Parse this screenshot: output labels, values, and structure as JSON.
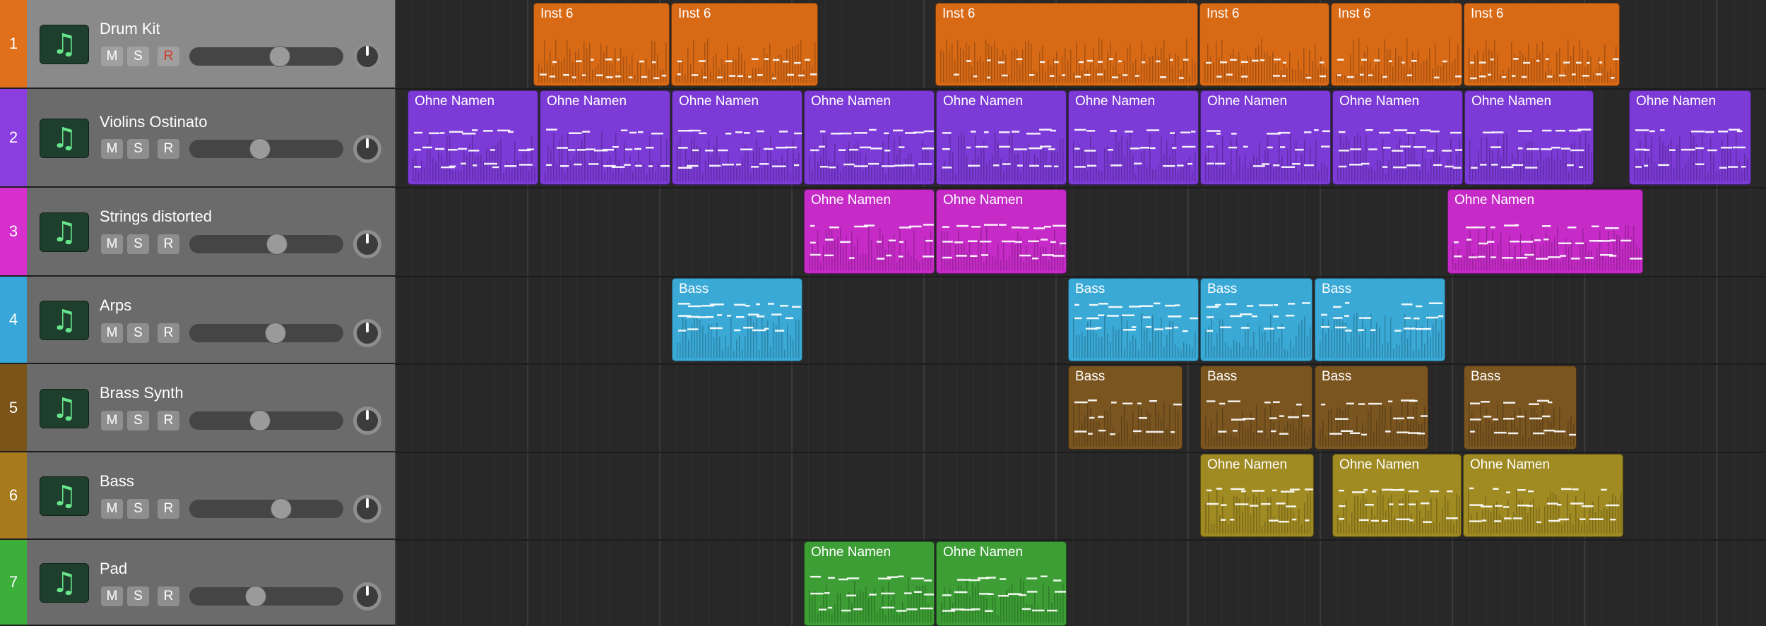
{
  "tracks": [
    {
      "number": "1",
      "name": "Drum Kit",
      "color": "#e0701a",
      "mute": "M",
      "solo": "S",
      "record": "R",
      "record_armed": true,
      "selected": true,
      "volume": 0.6
    },
    {
      "number": "2",
      "name": "Violins Ostinato",
      "color": "#8a3ee0",
      "mute": "M",
      "solo": "S",
      "record": "R",
      "record_armed": false,
      "selected": false,
      "volume": 0.45
    },
    {
      "number": "3",
      "name": "Strings distorted",
      "color": "#d62fcd",
      "mute": "M",
      "solo": "S",
      "record": "R",
      "record_armed": false,
      "selected": false,
      "volume": 0.58
    },
    {
      "number": "4",
      "name": "Arps",
      "color": "#36a7d8",
      "mute": "M",
      "solo": "S",
      "record": "R",
      "record_armed": false,
      "selected": false,
      "volume": 0.57
    },
    {
      "number": "5",
      "name": "Brass Synth",
      "color": "#7a5418",
      "mute": "M",
      "solo": "S",
      "record": "R",
      "record_armed": false,
      "selected": false,
      "volume": 0.45
    },
    {
      "number": "6",
      "name": "Bass",
      "color": "#a87a1e",
      "mute": "M",
      "solo": "S",
      "record": "R",
      "record_armed": false,
      "selected": false,
      "volume": 0.61
    },
    {
      "number": "7",
      "name": "Pad",
      "color": "#3cae3a",
      "mute": "M",
      "solo": "S",
      "record": "R",
      "record_armed": false,
      "selected": false,
      "volume": 0.42
    }
  ],
  "icons": {
    "track_instrument": "music-note-icon"
  },
  "regions": {
    "drum_label": "Inst 6",
    "violins_label": "Ohne Namen",
    "strings_label": "Ohne Namen",
    "arps_label": "Bass",
    "brass_label": "Bass",
    "bass_label": "Ohne Namen",
    "pad_label": "Ohne Namen"
  },
  "colors": {
    "drum_region": "#d86a16",
    "violins_region": "#7c3ad6",
    "strings_region": "#c62bc8",
    "arps_region": "#3aa9d6",
    "brass_region": "#7a5520",
    "bass_region": "#a08a22",
    "pad_region": "#3c9e34"
  }
}
